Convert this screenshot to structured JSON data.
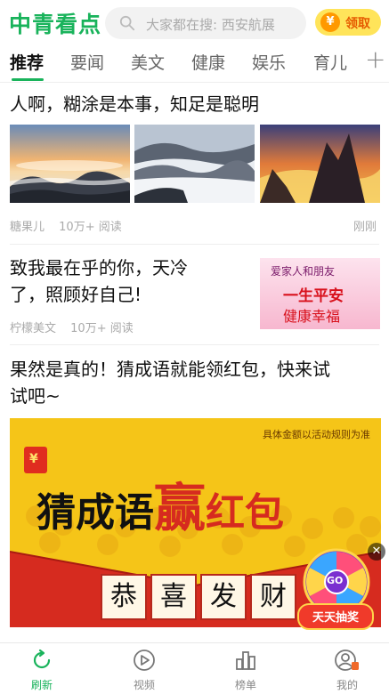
{
  "header": {
    "logo": "中青看点",
    "search_placeholder": "大家都在搜: 西安航展",
    "reward_label": "领取",
    "reward_coin": "¥"
  },
  "tabs": [
    {
      "label": "推荐",
      "active": true
    },
    {
      "label": "要闻"
    },
    {
      "label": "美文"
    },
    {
      "label": "健康"
    },
    {
      "label": "娱乐"
    },
    {
      "label": "育儿"
    }
  ],
  "feed": [
    {
      "title": "人啊，糊涂是本事，知足是聪明",
      "source": "糖果儿",
      "reads": "10万+ 阅读",
      "time": "刚刚"
    },
    {
      "title_line1": "致我最在乎的你，天冷",
      "title_line2": "了，照顾好自己!",
      "source": "柠檬美文",
      "reads": "10万+ 阅读",
      "thumb_text": {
        "line1": "爱家人和朋友",
        "line2": "一生平安",
        "line3": "健康幸福"
      }
    },
    {
      "title_line1": "果然是真的！猜成语就能领红包，快来试",
      "title_line2": "试吧~",
      "ad": {
        "disclaimer": "具体金额以活动规则为准",
        "headline_a": "猜成语",
        "headline_b": "赢",
        "headline_c": "红包",
        "tiles": [
          "恭",
          "喜",
          "发",
          "财"
        ],
        "wheel_label": "GO",
        "lottery_label": "天天抽奖",
        "envelope_symbol": "¥"
      }
    }
  ],
  "bottom_nav": [
    {
      "label": "刷新",
      "active": true
    },
    {
      "label": "视频"
    },
    {
      "label": "榜单"
    },
    {
      "label": "我的"
    }
  ],
  "colors": {
    "brand": "#19b35b",
    "ad_red": "#d62b1f",
    "ad_yellow": "#f5c518"
  }
}
